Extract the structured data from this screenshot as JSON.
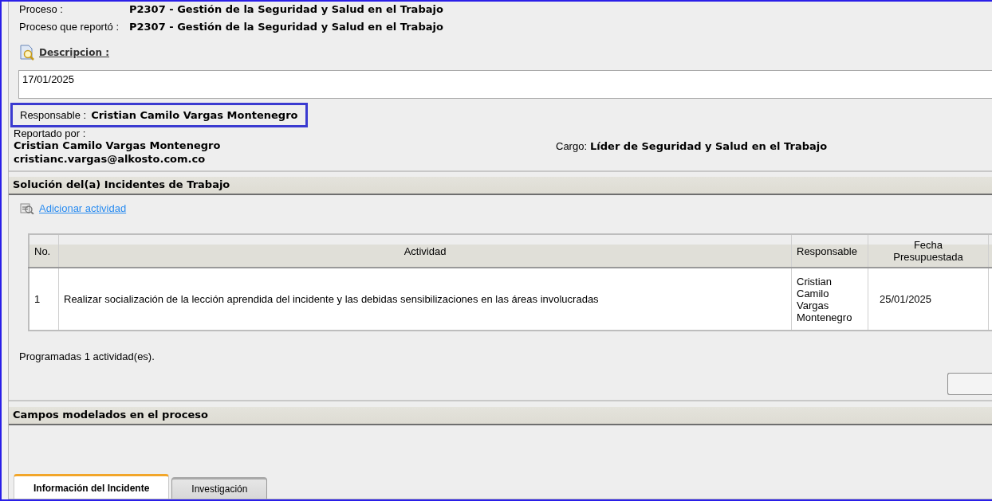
{
  "process": {
    "label": "Proceso :",
    "value": "P2307 - Gestión de la Seguridad y Salud en el Trabajo"
  },
  "reporting_process": {
    "label": "Proceso que reportó :",
    "value": "P2307 - Gestión de la Seguridad y Salud en el Trabajo"
  },
  "description": {
    "label": "Descripcion :",
    "value": "17/01/2025"
  },
  "responsible": {
    "label": "Responsable :",
    "value": "Cristian Camilo Vargas Montenegro",
    "highlighted": true
  },
  "reported_by": {
    "label": "Reportado por :",
    "name": "Cristian Camilo Vargas Montenegro",
    "email": "cristianc.vargas@alkosto.com.co"
  },
  "position": {
    "label": "Cargo:",
    "value": "Líder de Seguridad y Salud en el Trabajo"
  },
  "solution_section": {
    "title": "Solución del(a) Incidentes de Trabajo",
    "add_link": "Adicionar actividad",
    "table": {
      "columns": [
        "No.",
        "Actividad",
        "Responsable",
        "Fecha Presupuestada"
      ],
      "rows": [
        [
          "1",
          "Realizar socialización de la lección aprendida del incidente y las debidas sensibilizaciones en las áreas involucradas",
          "Cristian Camilo Vargas Montenegro",
          "25/01/2025"
        ]
      ]
    },
    "summary": "Programadas 1 actividad(es)."
  },
  "fields_section": {
    "title": "Campos modelados en el proceso",
    "tabs": [
      {
        "label": "Información del Incidente",
        "selected": true
      },
      {
        "label": "Investigación",
        "selected": false
      }
    ]
  }
}
